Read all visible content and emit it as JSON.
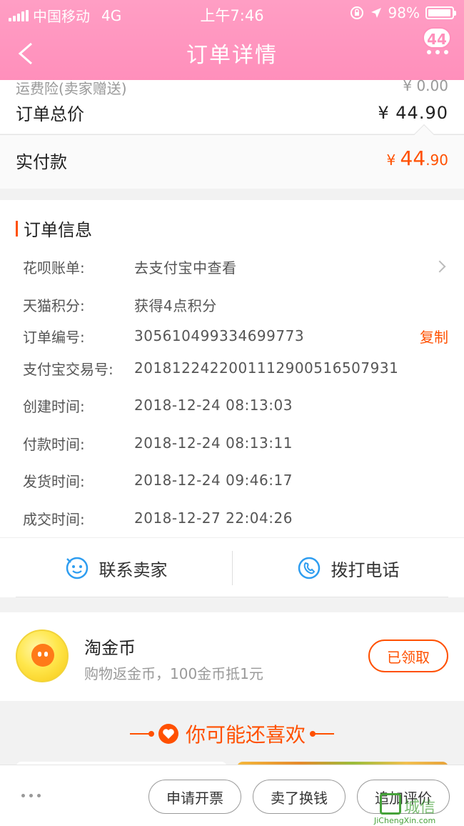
{
  "status_bar": {
    "carrier": "中国移动",
    "network": "4G",
    "time": "上午7:46",
    "battery_text": "98%",
    "battery_level": 0.98
  },
  "header": {
    "title": "订单详情",
    "badge_count": "44",
    "back_icon": "chevron-left-icon",
    "more_icon": "more-dots-icon"
  },
  "price": {
    "freight_label": "运费险(卖家赠送)",
    "freight_value": "¥ 0.00",
    "total_label": "订单总价",
    "total_value": "¥ 44.90",
    "paid_label": "实付款",
    "paid_currency": "¥",
    "paid_int": "44",
    "paid_dec": ".90"
  },
  "order_info": {
    "title": "订单信息",
    "rows": [
      {
        "key": "花呗账单:",
        "value": "去支付宝中查看"
      },
      {
        "key": "天猫积分:",
        "value": "获得4点积分"
      },
      {
        "key": "订单编号:",
        "value": "305610499334699773",
        "action": "复制"
      },
      {
        "key": "支付宝交易号:",
        "value": "2018122422001112900516507931"
      },
      {
        "key": "创建时间:",
        "value": "2018-12-24 08:13:03"
      },
      {
        "key": "付款时间:",
        "value": "2018-12-24 08:13:11"
      },
      {
        "key": "发货时间:",
        "value": "2018-12-24 09:46:17"
      },
      {
        "key": "成交时间:",
        "value": "2018-12-27 22:04:26"
      }
    ]
  },
  "contact": {
    "seller_label": "联系卖家",
    "phone_label": "拨打电话"
  },
  "coin": {
    "title": "淘金币",
    "subtitle": "购物返金币，100金币抵1元",
    "button": "已领取"
  },
  "recommend": {
    "title": "你可能还喜欢"
  },
  "bottom_bar": {
    "invoice": "申请开票",
    "sell": "卖了换钱",
    "review": "追加评价"
  },
  "watermark": {
    "text": "城信",
    "url": "JiChengXin.com"
  },
  "colors": {
    "header_pink": "#ff8fbb",
    "accent_orange": "#ff5000"
  }
}
